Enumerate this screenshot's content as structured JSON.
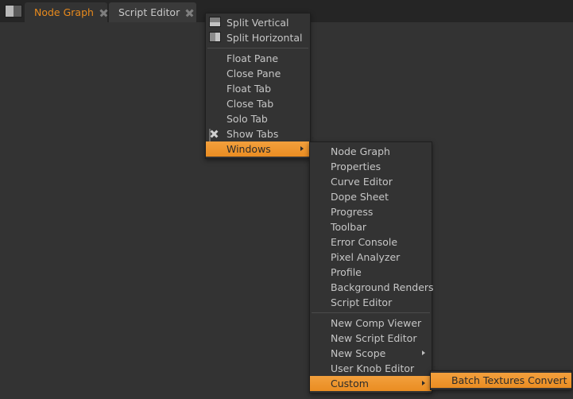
{
  "window": {
    "background_color": "#333333",
    "tabbar_color": "#252525",
    "accent_color": "#ea8d22"
  },
  "tabbar": {
    "pane_split_button": "pane-split-icon",
    "tabs": [
      {
        "label": "Node Graph",
        "active": true,
        "close": "close-icon"
      },
      {
        "label": "Script Editor",
        "active": false,
        "close": "close-icon"
      }
    ]
  },
  "pane_menu": {
    "items": [
      {
        "label": "Split Vertical",
        "icon": "split-vertical-icon",
        "highlighted": false,
        "submenu": false
      },
      {
        "label": "Split Horizontal",
        "icon": "split-horizontal-icon",
        "highlighted": false,
        "submenu": false
      },
      {
        "separator": true
      },
      {
        "label": "Float Pane",
        "icon": "",
        "highlighted": false,
        "submenu": false
      },
      {
        "label": "Close Pane",
        "icon": "",
        "highlighted": false,
        "submenu": false
      },
      {
        "label": "Float Tab",
        "icon": "",
        "highlighted": false,
        "submenu": false
      },
      {
        "label": "Close Tab",
        "icon": "",
        "highlighted": false,
        "submenu": false
      },
      {
        "label": "Solo Tab",
        "icon": "",
        "highlighted": false,
        "submenu": false
      },
      {
        "label": "Show Tabs",
        "icon": "checkbox-checked-icon",
        "highlighted": false,
        "submenu": false
      },
      {
        "label": "Windows",
        "icon": "",
        "highlighted": true,
        "submenu": true
      }
    ]
  },
  "windows_menu": {
    "items": [
      {
        "label": "Node Graph",
        "highlighted": false,
        "submenu": false
      },
      {
        "label": "Properties",
        "highlighted": false,
        "submenu": false
      },
      {
        "label": "Curve Editor",
        "highlighted": false,
        "submenu": false
      },
      {
        "label": "Dope Sheet",
        "highlighted": false,
        "submenu": false
      },
      {
        "label": "Progress",
        "highlighted": false,
        "submenu": false
      },
      {
        "label": "Toolbar",
        "highlighted": false,
        "submenu": false
      },
      {
        "label": "Error Console",
        "highlighted": false,
        "submenu": false
      },
      {
        "label": "Pixel Analyzer",
        "highlighted": false,
        "submenu": false
      },
      {
        "label": "Profile",
        "highlighted": false,
        "submenu": false
      },
      {
        "label": "Background Renders",
        "highlighted": false,
        "submenu": false
      },
      {
        "label": "Script Editor",
        "highlighted": false,
        "submenu": false
      },
      {
        "separator": true
      },
      {
        "label": "New Comp Viewer",
        "highlighted": false,
        "submenu": false
      },
      {
        "label": "New Script Editor",
        "highlighted": false,
        "submenu": false
      },
      {
        "label": "New Scope",
        "highlighted": false,
        "submenu": true
      },
      {
        "label": "User Knob Editor",
        "highlighted": false,
        "submenu": false
      },
      {
        "label": "Custom",
        "highlighted": true,
        "submenu": true
      }
    ]
  },
  "custom_menu": {
    "items": [
      {
        "label": "Batch Textures Convert",
        "highlighted": true,
        "submenu": false
      }
    ]
  }
}
